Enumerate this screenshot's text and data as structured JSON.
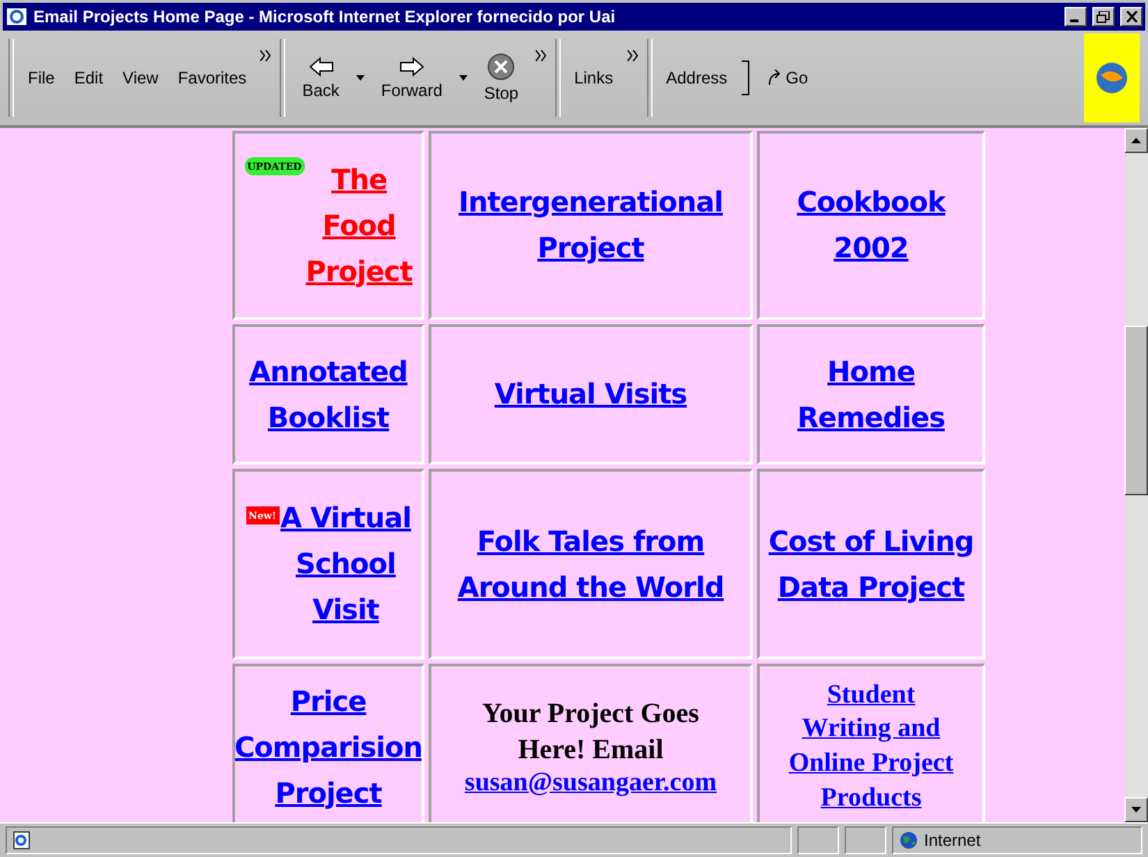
{
  "window": {
    "title": "Email Projects Home Page - Microsoft Internet Explorer fornecido por Uai"
  },
  "menu": [
    "File",
    "Edit",
    "View",
    "Favorites"
  ],
  "nav_buttons": [
    {
      "label": "Back",
      "kind": "back"
    },
    {
      "label": "Forward",
      "kind": "forward"
    },
    {
      "label": "Stop",
      "kind": "stop"
    }
  ],
  "links_label": "Links",
  "address_label": "Address",
  "go_label": "Go",
  "rows": [
    [
      {
        "kind": "link",
        "color": "#ff0000",
        "badge": {
          "kind": "updated",
          "text": "UPDATED"
        },
        "lines": [
          "The",
          "Food",
          "Project"
        ]
      },
      {
        "kind": "link",
        "color": "#0000ff",
        "lines": [
          "Intergenerational",
          "Project"
        ]
      },
      {
        "kind": "link",
        "color": "#0000ff",
        "lines": [
          "Cookbook",
          "2002"
        ]
      }
    ],
    [
      {
        "kind": "link",
        "color": "#0000ff",
        "lines": [
          "Annotated",
          "Booklist"
        ]
      },
      {
        "kind": "link",
        "color": "#0000ff",
        "lines": [
          "Virtual Visits"
        ]
      },
      {
        "kind": "link",
        "color": "#0000ff",
        "lines": [
          "Home",
          "Remedies"
        ]
      }
    ],
    [
      {
        "kind": "link",
        "color": "#0000ff",
        "badge": {
          "kind": "new",
          "text": "New!"
        },
        "lines": [
          "A Virtual",
          "School",
          "Visit"
        ]
      },
      {
        "kind": "link",
        "color": "#0000ff",
        "lines": [
          "Folk Tales from",
          "Around the World"
        ]
      },
      {
        "kind": "link",
        "color": "#0000ff",
        "lines": [
          "Cost of Living",
          "Data Project"
        ]
      }
    ],
    [
      {
        "kind": "link",
        "color": "#0000ff",
        "lines": [
          "Price",
          "Comparision",
          "Project"
        ]
      },
      {
        "kind": "text_link",
        "color": "#000000",
        "lines": [
          "Your Project Goes",
          "Here! Email"
        ],
        "link": "susan@susangaer.com"
      },
      {
        "kind": "serif_link",
        "color": "#0000ff",
        "lines": [
          "Student",
          "Writing and",
          "Online Project",
          "Products"
        ]
      }
    ]
  ],
  "status_bar": {
    "zone": "Internet"
  }
}
